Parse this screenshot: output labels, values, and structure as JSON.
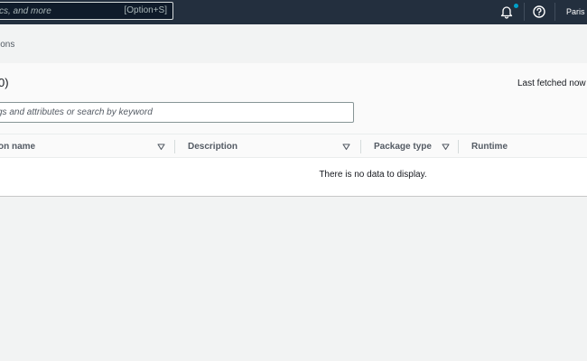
{
  "topbar": {
    "search_placeholder": "cs, and more",
    "search_shortcut": "[Option+S]",
    "region": "Paris",
    "icons": {
      "notifications": "bell-icon",
      "help": "help-circle-icon"
    },
    "colors": {
      "bar": "#232f3e",
      "notification_dot": "#00a1c9"
    }
  },
  "breadcrumb": {
    "current": "ions"
  },
  "panel": {
    "count": "0)",
    "last_fetched": "Last fetched now",
    "filter_placeholder": "gs and attributes or search by keyword"
  },
  "table": {
    "columns": [
      {
        "label": "on name"
      },
      {
        "label": "Description"
      },
      {
        "label": "Package type"
      },
      {
        "label": "Runtime"
      }
    ],
    "empty_message": "There is no data to display."
  }
}
